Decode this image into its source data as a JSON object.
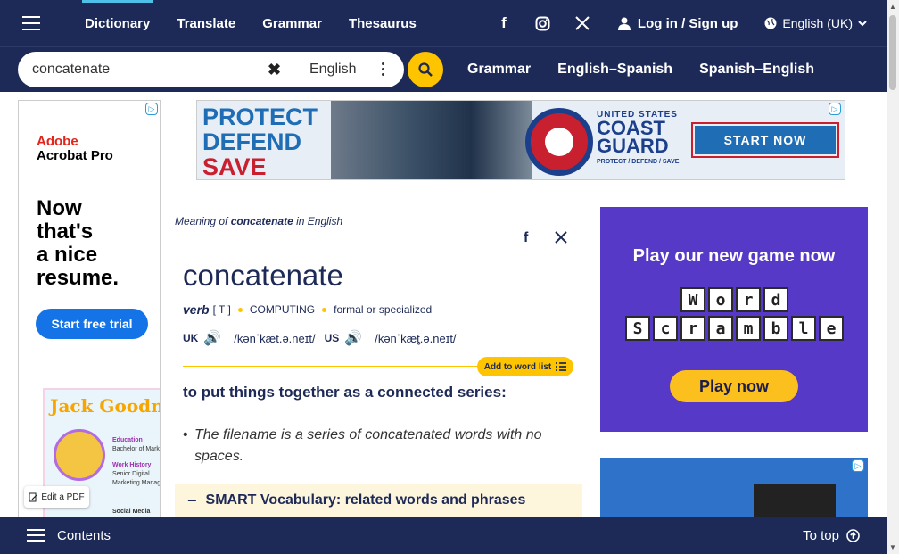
{
  "nav": {
    "tabs": [
      "Dictionary",
      "Translate",
      "Grammar",
      "Thesaurus"
    ],
    "login_label": "Log in / Sign up",
    "language_label": "English (UK)"
  },
  "search": {
    "query": "concatenate",
    "dictionary_label": "English",
    "links": [
      "Grammar",
      "English–Spanish",
      "Spanish–English"
    ]
  },
  "left_ad": {
    "brand_line1": "Adobe",
    "brand_line2": "Acrobat Pro",
    "headline": [
      "Now",
      "that's",
      "a nice",
      "resume."
    ],
    "cta": "Start free trial",
    "resume_title": "Jack Goodn",
    "resume_lines": [
      "Education",
      "Bachelor of Marketing",
      "Work History",
      "Senior Digital",
      "Marketing Manager",
      "Social Media Specialist"
    ],
    "edit_pdf": "Edit a PDF"
  },
  "banner_ad": {
    "line1": "PROTECT",
    "line2": "DEFEND",
    "line3": "SAVE",
    "org_small": "UNITED STATES",
    "org_big1": "COAST",
    "org_big2": "GUARD",
    "tagline": "PROTECT / DEFEND / SAVE",
    "cta": "START NOW"
  },
  "entry": {
    "meaning_prefix": "Meaning of",
    "headword": "concatenate",
    "meaning_suffix": "in English",
    "pos": "verb",
    "grammar_code": "[ T ]",
    "domain": "COMPUTING",
    "register": "formal or specialized",
    "uk_label": "UK",
    "uk_ipa": "/kənˈkæt.ə.neɪt/",
    "us_label": "US",
    "us_ipa": "/kənˈkæt̬.ə.neɪt/",
    "add_to_list": "Add to word list",
    "definition": "to put things together as a connected series:",
    "example": "The filename is a series of concatenated words with no spaces.",
    "smart_vocab": "SMART Vocabulary: related words and phrases"
  },
  "game_ad": {
    "title": "Play our new game now",
    "row1": [
      "W",
      "o",
      "r",
      "d"
    ],
    "row2": [
      "S",
      "c",
      "r",
      "a",
      "m",
      "b",
      "l",
      "e"
    ],
    "cta": "Play now"
  },
  "bottom": {
    "contents": "Contents",
    "to_top": "To top"
  },
  "colors": {
    "navy": "#1d2a57",
    "yellow": "#fec400",
    "accent_blue": "#4fc1e9"
  }
}
